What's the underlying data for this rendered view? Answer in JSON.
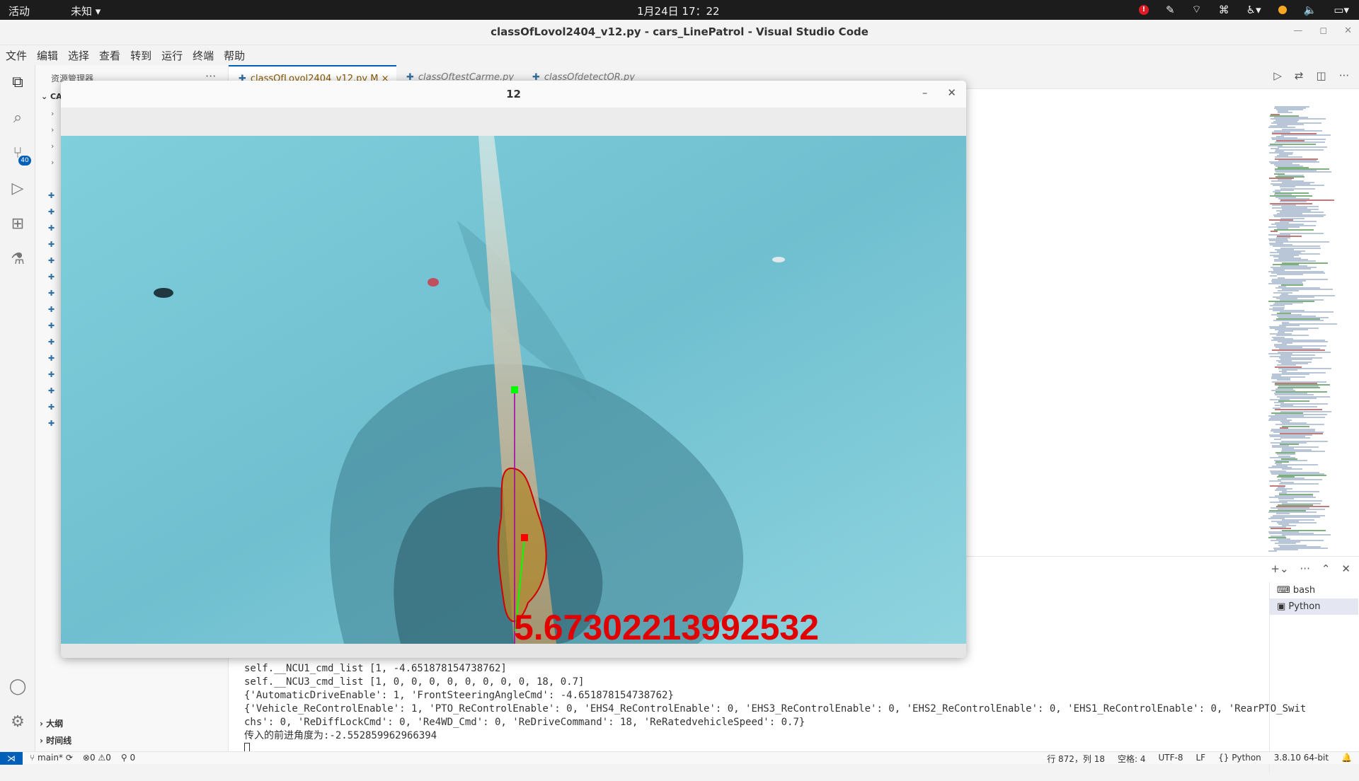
{
  "topbar": {
    "activities": "活动",
    "app_menu": "未知",
    "clock": "1月24日  17：22"
  },
  "window": {
    "title": "classOfLovol2404_v12.py - cars_LinePatrol - Visual Studio Code"
  },
  "menu": [
    "文件",
    "编辑",
    "选择",
    "查看",
    "转到",
    "运行",
    "终端",
    "帮助"
  ],
  "activity_bar": {
    "scm_badge": "40"
  },
  "sidebar": {
    "header": "资源管理器",
    "more": "···",
    "root_label": "CA",
    "outline": "大纲",
    "timeline": "时间线"
  },
  "tabs": [
    {
      "label": "classOfLovol2404_v12.py",
      "modified": "M",
      "close": "×"
    },
    {
      "label": "classOftestCarme.py"
    },
    {
      "label": "classOfdetectOR.py"
    }
  ],
  "panel": {
    "terminals": [
      "bash",
      "Python"
    ],
    "lines": [
      "self.__NCU1_cmd_list [1, -4.651878154738762]",
      "self.__NCU3_cmd_list [1, 0, 0, 0, 0, 0, 0, 0, 0, 18, 0.7]",
      "{'AutomaticDriveEnable': 1, 'FrontSteeringAngleCmd': -4.651878154738762}",
      "{'Vehicle_ReControlEnable': 1, 'PTO_ReControlEnable': 0, 'EHS4_ReControlEnable': 0, 'EHS3_ReControlEnable': 0, 'EHS2_ReControlEnable': 0, 'EHS1_ReControlEnable': 0, 'RearPTO_Swit",
      "chs': 0, 'ReDiffLockCmd': 0, 'Re4WD_Cmd': 0, 'ReDriveCommand': 18, 'ReRatedvehicleSpeed': 0.7}",
      "传入的前进角度为:-2.552859962966394"
    ]
  },
  "statusbar": {
    "branch": "main*",
    "errors": "0",
    "warnings": "0",
    "ports": "0",
    "position": "行 872，列 18",
    "spaces": "空格: 4",
    "encoding": "UTF-8",
    "eol": "LF",
    "language": "Python",
    "interpreter": "3.8.10 64-bit"
  },
  "cv_window": {
    "title": "12",
    "overlay_value": "5.67302213992532"
  },
  "colors": {
    "accent": "#005fb8",
    "overlay_red": "#e00000",
    "marker_green": "#00ff00"
  }
}
